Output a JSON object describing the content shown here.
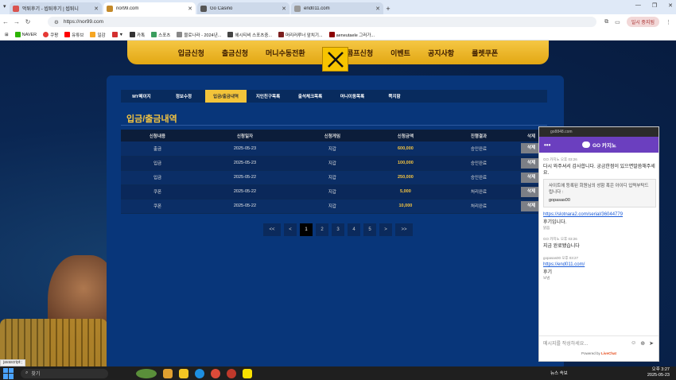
{
  "browser": {
    "tabs": [
      {
        "title": "먹튀후기 - 씹튀후기 | 씹튀니",
        "active": false
      },
      {
        "title": "nor99.com",
        "active": true
      },
      {
        "title": "Go Casino",
        "active": false
      },
      {
        "title": "end011.com",
        "active": false
      }
    ],
    "url": "https://nor99.com",
    "profile_label": "일시 중지됨",
    "bookmarks": [
      "NAVER",
      "쿠팡",
      "유튜브",
      "일감",
      "▼",
      "카톡",
      "스포츠",
      "블로나라 - 2024년...",
      "헤시티비 스포츠중...",
      "머리러루너 앞치기...",
      "aeneutaele 그러가..."
    ],
    "status_text": "javascript:;"
  },
  "site": {
    "top_nav": [
      "입금신청",
      "출금신청",
      "머니수동전환",
      "쿠",
      "콤프신청",
      "이벤트",
      "공지사항",
      "룰렛쿠폰"
    ],
    "sub_nav": [
      {
        "label": "MY페이지",
        "active": false
      },
      {
        "label": "정보수정",
        "active": false
      },
      {
        "label": "입금/출금내역",
        "active": true
      },
      {
        "label": "지인친구목록",
        "active": false
      },
      {
        "label": "출석체크목록",
        "active": false
      },
      {
        "label": "머니이동목록",
        "active": false
      },
      {
        "label": "쪽지함",
        "active": false
      }
    ],
    "section_title": "입금/출금내역",
    "table": {
      "headers": [
        "신청내용",
        "신청일자",
        "신청게임",
        "신청금액",
        "진행결과",
        "삭제"
      ],
      "rows": [
        [
          "출금",
          "2025-05-23",
          "지갑",
          "600,000",
          "승인완료",
          "삭제"
        ],
        [
          "입금",
          "2025-05-23",
          "지갑",
          "100,000",
          "승인완료",
          "삭제"
        ],
        [
          "입금",
          "2025-05-22",
          "지갑",
          "250,000",
          "승인완료",
          "삭제"
        ],
        [
          "쿠폰",
          "2025-05-22",
          "지갑",
          "5,000",
          "처리완료",
          "삭제"
        ],
        [
          "쿠폰",
          "2025-05-22",
          "지갑",
          "10,000",
          "처리완료",
          "삭제"
        ]
      ]
    },
    "pagination": {
      "first": "<<",
      "prev": "<",
      "pages": [
        "1",
        "2",
        "3",
        "4",
        "5"
      ],
      "current": "1",
      "next": ">",
      "last": ">>"
    }
  },
  "chat": {
    "top_url": "go8848.com",
    "header_dots": "•••",
    "brand": "GO 카지노",
    "messages": {
      "m1_meta": "GO 카지노 오후 03:26",
      "m1_text": "다시 와주셔서 감사합니다. 궁금한점이 있으면말씀해주세요.",
      "box_text": "사이트에 등록된 회원님의 성함 혹은 아이디 입력부탁드립니다 :",
      "box_value": "gopasas00",
      "link1": "https://slotnara2.com/serial/36044779",
      "review_text": "후기입니다.",
      "review_small": "읽음",
      "m2_meta": "GO 카지노 오후 03:26",
      "m2_text": "지금 완료됐습니다",
      "m3_meta": "gopasas00 오후 03:27",
      "link2": "https://end011.com/",
      "m3_text": "후기",
      "m3_small": "보냄"
    },
    "input_placeholder": "메시지를 작성하세요...",
    "powered_prefix": "Powered by",
    "powered_brand": "LiveChat"
  },
  "taskbar": {
    "search_label": "찾기",
    "news": "뉴스 속보",
    "time": "오후 3:27",
    "date": "2025-05-23"
  }
}
